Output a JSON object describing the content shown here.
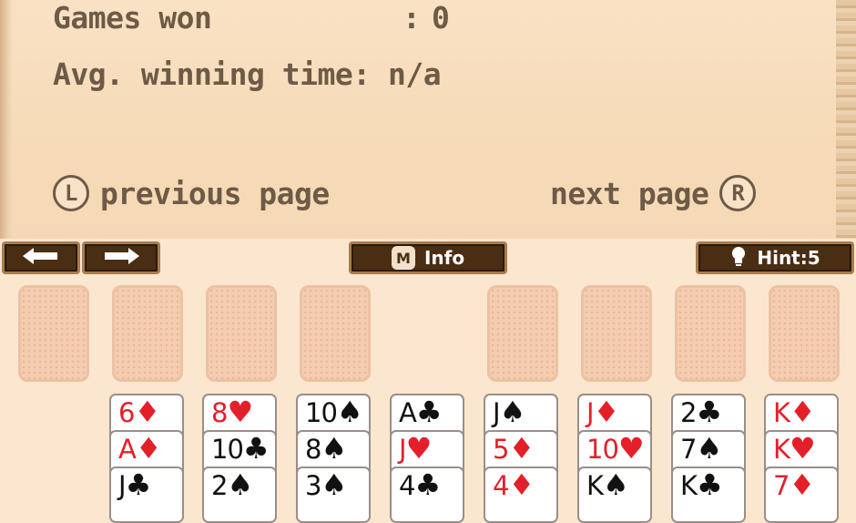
{
  "stats": {
    "games_won_label": "Games won",
    "games_won_sep": ":",
    "games_won_value": "0",
    "avg_time_label": "Avg. winning time:",
    "avg_time_value": "n/a"
  },
  "pager": {
    "prev_key": "L",
    "prev_label": "previous page",
    "next_label": "next page",
    "next_key": "R"
  },
  "toolbar": {
    "undo_icon": "undo-arrow-icon",
    "redo_icon": "redo-arrow-icon",
    "info_key": "M",
    "info_label": "Info",
    "hint_label": "Hint:5"
  },
  "colors": {
    "parchment": "#f7dcba",
    "text_brown": "#6d5a47",
    "button_dark": "#4a2e13",
    "button_border": "#a97c4f",
    "card_red": "#e3202a",
    "card_black": "#111111",
    "slot_fill": "#f4cdb0"
  },
  "tableau": [
    {
      "cards": [
        {
          "rank": "6",
          "suit": "♦",
          "color": "red"
        },
        {
          "rank": "A",
          "suit": "♦",
          "color": "red"
        },
        {
          "rank": "J",
          "suit": "♣",
          "color": "black"
        }
      ]
    },
    {
      "cards": [
        {
          "rank": "8",
          "suit": "♥",
          "color": "red"
        },
        {
          "rank": "10",
          "suit": "♣",
          "color": "black"
        },
        {
          "rank": "2",
          "suit": "♠",
          "color": "black"
        }
      ]
    },
    {
      "cards": [
        {
          "rank": "10",
          "suit": "♠",
          "color": "black"
        },
        {
          "rank": "8",
          "suit": "♠",
          "color": "black"
        },
        {
          "rank": "3",
          "suit": "♠",
          "color": "black"
        }
      ]
    },
    {
      "cards": [
        {
          "rank": "A",
          "suit": "♣",
          "color": "black"
        },
        {
          "rank": "J",
          "suit": "♥",
          "color": "red"
        },
        {
          "rank": "4",
          "suit": "♣",
          "color": "black"
        }
      ]
    },
    {
      "cards": [
        {
          "rank": "J",
          "suit": "♠",
          "color": "black"
        },
        {
          "rank": "5",
          "suit": "♦",
          "color": "red"
        },
        {
          "rank": "4",
          "suit": "♦",
          "color": "red"
        }
      ]
    },
    {
      "cards": [
        {
          "rank": "J",
          "suit": "♦",
          "color": "red"
        },
        {
          "rank": "10",
          "suit": "♥",
          "color": "red"
        },
        {
          "rank": "K",
          "suit": "♠",
          "color": "black"
        }
      ]
    },
    {
      "cards": [
        {
          "rank": "2",
          "suit": "♣",
          "color": "black"
        },
        {
          "rank": "7",
          "suit": "♠",
          "color": "black"
        },
        {
          "rank": "K",
          "suit": "♣",
          "color": "black"
        }
      ]
    },
    {
      "cards": [
        {
          "rank": "K",
          "suit": "♦",
          "color": "red"
        },
        {
          "rank": "K",
          "suit": "♥",
          "color": "red"
        },
        {
          "rank": "7",
          "suit": "♦",
          "color": "red"
        }
      ]
    }
  ]
}
